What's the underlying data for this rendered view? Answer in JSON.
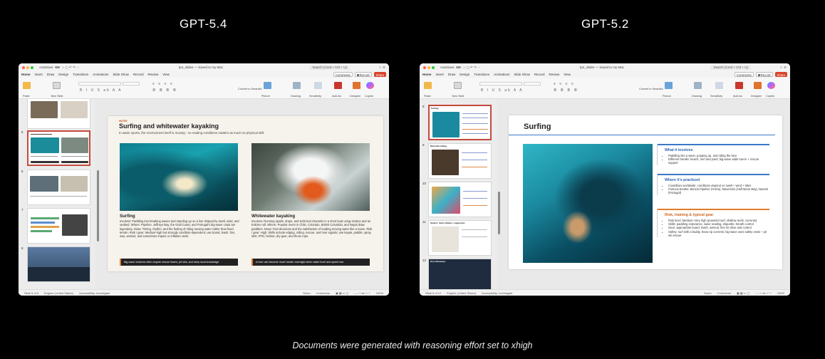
{
  "headings": {
    "left": "GPT-5.4",
    "right": "GPT-5.2"
  },
  "caption": "Documents were generated with reasoning effort set to xhigh",
  "colors": {
    "accent": "#c43e1c",
    "share": "#d8432a",
    "selected_thumb": "#c4493b",
    "blue_rule": "#3b78c7",
    "orange_rule": "#e07b28"
  },
  "window_common": {
    "autosave": "AutoSave",
    "search": "Search (Cmd + Ctrl + U)",
    "tabs": [
      "Home",
      "Insert",
      "Draw",
      "Design",
      "Transitions",
      "Animations",
      "Slide Show",
      "Record",
      "Review",
      "View"
    ],
    "comments": "Comments",
    "record": "Record",
    "share": "Share",
    "ribbon": {
      "paste": "Paste",
      "new_slide": "New Slide",
      "convert": "Convert to SmartArt",
      "picture": "Picture",
      "drawing": "Drawing",
      "sensitivity": "Sensitivity",
      "addins": "Add-ins",
      "designer": "Designer",
      "copilot": "Copilot"
    },
    "status_lang": "English (United States)",
    "accessibility": "Accessibility: Investigate",
    "notes": "Notes",
    "status_comments": "Comments",
    "zoom": "100%"
  },
  "left_window": {
    "doc_title": "tp4_slides — Saved to my Mac",
    "status_slide": "Slide 5 of 8",
    "thumb_numbers": [
      "5",
      "6",
      "7",
      "8"
    ],
    "slide": {
      "kicker": "WATER",
      "title": "Surfing and whitewater kayaking",
      "subtitle": "In water sports, the environment itself is moving - so reading conditions matters as much as physical skill.",
      "columns": [
        {
          "heading": "Surfing",
          "body": "Involves: Paddling into breaking waves and standing up on a line shaped by swell, wind, and seabed. Where: Pipeline, Jeffreys Bay, the Gold Coast, and Portugal's big-wave coast are legendary. Draw: Timing, rhythm, and the feeling of riding moving water rather than fixed terrain. Risk / gear: Medium-high but strongly condition-dependent; use board, leash, fins, wax, wetsuit, and sometimes impact or inflation vests.",
          "banner": "Big-wave ventures often require rescue teams, jet skis, and deep local knowledge."
        },
        {
          "heading": "Whitewater kayaking",
          "body": "Involves: Running rapids, drops, and technical channels in a short boat using strokes and an Eskimo roll. Where: Popular rivers in Chile, Colorado, British Columbia, and Nepal draw paddlers. Draw: Fast decisions and the satisfaction of reading moving water like a maze. Risk / gear: High: Skills include edging, rolling, rescue, and river signals; use kayak, paddle, spray skirt, PFD, helmet, dry gear, and throw rope.",
          "banner": "A river can become much harder overnight when water level and speed rise."
        }
      ]
    }
  },
  "right_window": {
    "doc_title": "tp2_slides — Saved to my Mac",
    "status_slide": "Slide 8 of 12",
    "thumb_numbers": [
      "8",
      "9",
      "10",
      "11",
      "12"
    ],
    "thumb_captions": [
      "Surfing",
      "Mountain biking",
      "",
      "Sphere: Stem athletic / equipment",
      "Key takeaways"
    ],
    "slide": {
      "title": "Surfing",
      "boxes": [
        {
          "heading": "What it involves",
          "items": [
            "Paddling into a wave, popping up, and riding the face",
            "Different breaks: beach, reef and point; big-wave adds tow-in + rescue support"
          ]
        },
        {
          "heading": "Where it's practiced",
          "items": [
            "Coastlines worldwide; conditions depend on swell + wind + tides",
            "Famous breaks: Banzai Pipeline (O'ahu), Mavericks (Half Moon Bay), Nazaré (Portugal)"
          ]
        },
        {
          "heading": "Risk, training & typical gear",
          "items": [
            "Risk level: Medium–Very high (powerful surf, shallow reefs, currents)",
            "Skills: paddling endurance, wave reading, etiquette, breath control",
            "Gear: appropriate board, leash, wetsuit; fins for drive and control",
            "Safety: surf with a buddy, know rip currents; big-wave uses safety vests + jet ski rescue"
          ]
        }
      ]
    }
  }
}
